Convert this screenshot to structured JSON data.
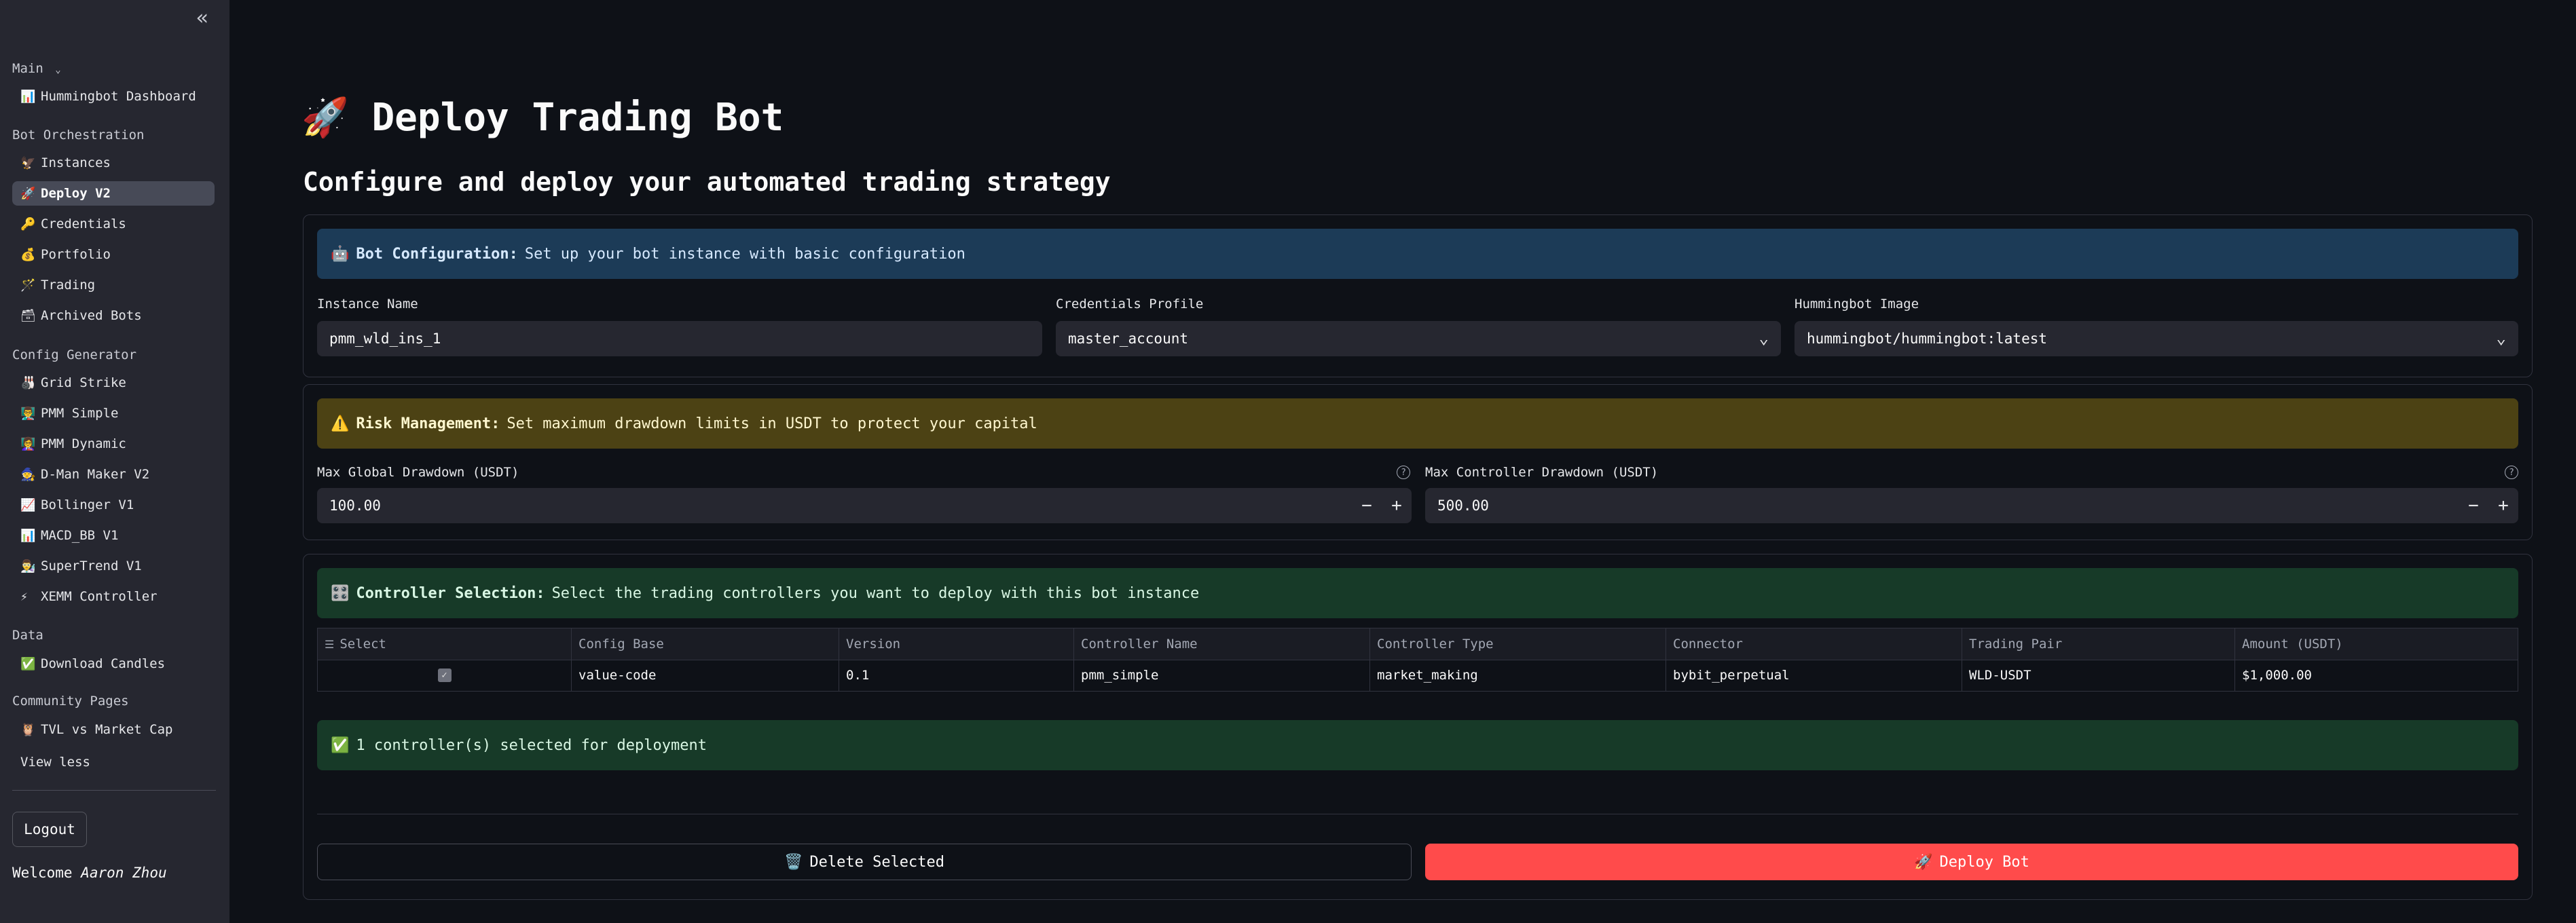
{
  "sidebar": {
    "collapse_icon": "double-chevron-left-icon",
    "sections": {
      "main": "Main",
      "bot_orchestration": "Bot Orchestration",
      "config_generator": "Config Generator",
      "data": "Data",
      "community": "Community Pages"
    },
    "main_items": [
      {
        "icon": "📊",
        "label": "Hummingbot Dashboard"
      }
    ],
    "orchestration_items": [
      {
        "icon": "🦅",
        "label": "Instances"
      },
      {
        "icon": "🚀",
        "label": "Deploy V2"
      },
      {
        "icon": "🔑",
        "label": "Credentials"
      },
      {
        "icon": "💰",
        "label": "Portfolio"
      },
      {
        "icon": "🪄",
        "label": "Trading"
      },
      {
        "icon": "🗃",
        "label": "Archived Bots"
      }
    ],
    "config_items": [
      {
        "icon": "🎳",
        "label": "Grid Strike"
      },
      {
        "icon": "👨‍🏫",
        "label": "PMM Simple"
      },
      {
        "icon": "👩‍🏫",
        "label": "PMM Dynamic"
      },
      {
        "icon": "🧙",
        "label": "D-Man Maker V2"
      },
      {
        "icon": "📈",
        "label": "Bollinger V1"
      },
      {
        "icon": "📊",
        "label": "MACD_BB V1"
      },
      {
        "icon": "👨‍🔬",
        "label": "SuperTrend V1"
      },
      {
        "icon": "⚡",
        "label": "XEMM Controller"
      }
    ],
    "data_items": [
      {
        "icon": "✅",
        "label": "Download Candles"
      }
    ],
    "community_items": [
      {
        "icon": "🦉",
        "label": "TVL vs Market Cap"
      }
    ],
    "view_less": "View less",
    "logout": "Logout",
    "welcome_prefix": "Welcome",
    "user_name": "Aaron Zhou"
  },
  "page": {
    "title_icon": "🚀",
    "title": "Deploy Trading Bot",
    "subtitle": "Configure and deploy your automated trading strategy"
  },
  "bot_config": {
    "banner_icon": "🤖",
    "banner_bold": "Bot Configuration:",
    "banner_text": "Set up your bot instance with basic configuration",
    "instance_name_label": "Instance Name",
    "instance_name_value": "pmm_wld_ins_1",
    "credentials_label": "Credentials Profile",
    "credentials_value": "master_account",
    "image_label": "Hummingbot Image",
    "image_value": "hummingbot/hummingbot:latest"
  },
  "risk": {
    "banner_icon": "⚠️",
    "banner_bold": "Risk Management:",
    "banner_text": "Set maximum drawdown limits in USDT to protect your capital",
    "global_label": "Max Global Drawdown (USDT)",
    "global_value": "100.00",
    "controller_label": "Max Controller Drawdown (USDT)",
    "controller_value": "500.00",
    "minus": "−",
    "plus": "+"
  },
  "controllers": {
    "banner_icon": "🎛️",
    "banner_bold": "Controller Selection:",
    "banner_text": "Select the trading controllers you want to deploy with this bot instance",
    "columns": [
      "Select",
      "Config Base",
      "Version",
      "Controller Name",
      "Controller Type",
      "Connector",
      "Trading Pair",
      "Amount (USDT)"
    ],
    "rows": [
      {
        "selected": true,
        "config_base": "value-code",
        "version": "0.1",
        "controller_name": "pmm_simple",
        "controller_type": "market_making",
        "connector": "bybit_perpetual",
        "trading_pair": "WLD-USDT",
        "amount": "$1,000.00"
      }
    ],
    "selected_icon": "✅",
    "selected_text": "1 controller(s) selected for deployment"
  },
  "actions": {
    "delete_icon": "🗑️",
    "delete_label": "Delete Selected",
    "deploy_icon": "🚀",
    "deploy_label": "Deploy Bot"
  },
  "colors": {
    "background": "#0e1117",
    "sidebar": "#262730",
    "primary": "#ff4b4b",
    "info_banner": "#1c3b57",
    "warning_banner": "#4c4214",
    "success_banner": "#173a28"
  }
}
